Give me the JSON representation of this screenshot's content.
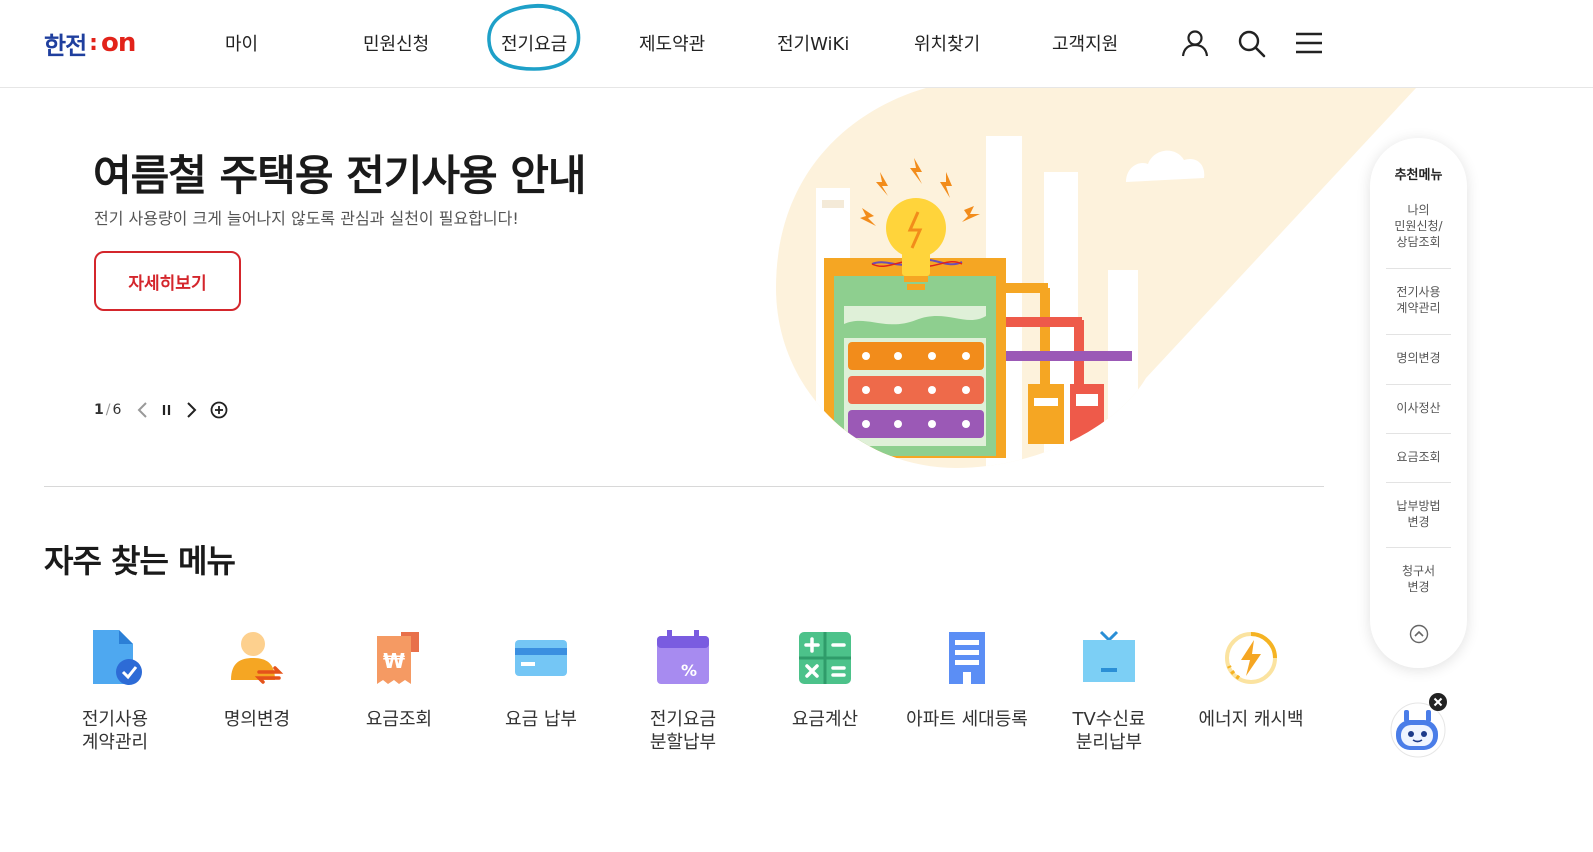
{
  "header": {
    "logo": {
      "ko": "한전",
      "colon": ":",
      "on": "on"
    },
    "nav": [
      "마이",
      "민원신청",
      "전기요금",
      "제도약관",
      "전기WiKi",
      "위치찾기",
      "고객지원"
    ],
    "icons": [
      "user-icon",
      "search-icon",
      "menu-icon"
    ]
  },
  "hero": {
    "title": "여름철 주택용 전기사용 안내",
    "subtitle": "전기 사용량이 크게 늘어나지 않도록 관심과 실천이 필요합니다!",
    "button": "자세히보기",
    "pager": {
      "current": "1",
      "separator": "/",
      "total": "6"
    }
  },
  "frequent": {
    "title": "자주 찾는 메뉴",
    "items": [
      {
        "label": "전기사용\n계약관리",
        "icon": "contract-doc-icon"
      },
      {
        "label": "명의변경",
        "icon": "name-change-icon"
      },
      {
        "label": "요금조회",
        "icon": "bill-receipt-icon"
      },
      {
        "label": "요금 납부",
        "icon": "card-icon"
      },
      {
        "label": "전기요금\n분할납부",
        "icon": "calendar-percent-icon"
      },
      {
        "label": "요금계산",
        "icon": "calculator-icon"
      },
      {
        "label": "아파트 세대등록",
        "icon": "apartment-icon"
      },
      {
        "label": "TV수신료\n분리납부",
        "icon": "tv-icon"
      },
      {
        "label": "에너지 캐시백",
        "icon": "energy-cashback-icon"
      }
    ]
  },
  "recommend": {
    "title": "추천메뉴",
    "items": [
      "나의\n민원신청/\n상담조회",
      "전기사용\n계약관리",
      "명의변경",
      "이사정산",
      "요금조회",
      "납부방법\n변경",
      "청구서\n변경"
    ]
  },
  "colors": {
    "brand_blue": "#1f3f9e",
    "brand_red": "#e2231a",
    "highlight_circle": "#1ea0c8"
  }
}
